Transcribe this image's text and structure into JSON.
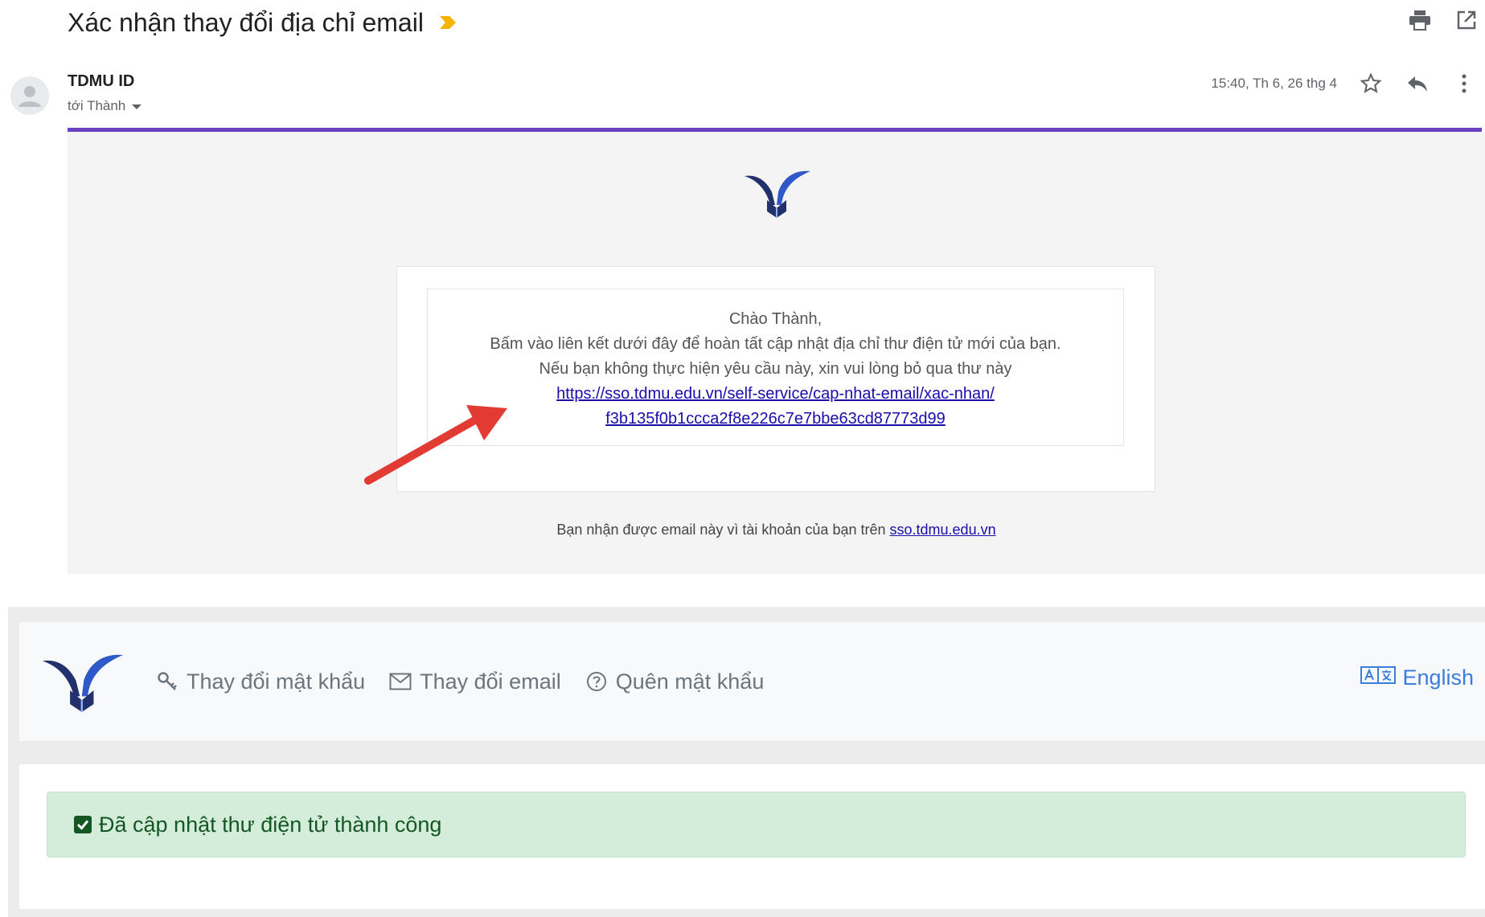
{
  "email": {
    "subject": "Xác nhận thay đổi địa chỉ email",
    "sender": "TDMU ID",
    "recipient": "tới Thành",
    "timestamp": "15:40, Th 6, 26 thg 4",
    "body": {
      "greeting": "Chào Thành,",
      "line1": "Bấm vào liên kết dưới đây để hoàn tất cập nhật địa chỉ thư điện tử mới của bạn.",
      "line2": "Nếu bạn không thực hiện yêu cầu này, xin vui lòng bỏ qua thư này",
      "link_part1": "https://sso.tdmu.edu.vn/self-service/cap-nhat-email/xac-nhan/",
      "link_part2": "f3b135f0b1ccca2f8e226c7e7bbe63cd87773d99"
    },
    "footer_text": "Bạn nhận được email này vì tài khoản của bạn trên",
    "footer_link": "sso.tdmu.edu.vn",
    "icons": [
      "print-icon",
      "open-new-window-icon",
      "star-icon",
      "reply-icon",
      "more-vert-icon",
      "importance-marker-icon"
    ]
  },
  "app": {
    "nav": {
      "change_password": "Thay đổi mật khẩu",
      "change_email": "Thay đổi email",
      "forgot_password": "Quên mật khẩu",
      "language": "English"
    },
    "alert": {
      "message": "Đã cập nhật thư điện tử thành công"
    }
  },
  "colors": {
    "accent_purple": "#6a3fc1",
    "link": "#1a0dab",
    "success_bg": "#d4edda",
    "success_text": "#155724",
    "logo_navy": "#22306b",
    "logo_blue": "#2f58c8",
    "arrow_red": "#e23b34"
  }
}
